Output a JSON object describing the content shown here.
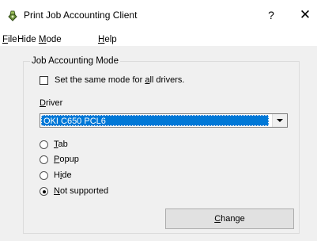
{
  "window": {
    "title": "Print Job Accounting Client",
    "help_glyph": "?",
    "close_glyph": "✕"
  },
  "menu": [
    {
      "pre": "",
      "key": "F",
      "post": "ile"
    },
    {
      "pre": "Hide ",
      "key": "M",
      "post": "ode"
    },
    {
      "pre": "",
      "key": "H",
      "post": "elp"
    }
  ],
  "group": {
    "title": "Job Accounting Mode",
    "same_mode_checkbox": {
      "pre": "Set the same mode for ",
      "key": "a",
      "post": "ll drivers.",
      "checked": false
    },
    "driver_label": {
      "pre": "",
      "key": "D",
      "post": "river"
    },
    "driver_value": "OKI C650 PCL6",
    "radios": [
      {
        "pre": "",
        "key": "T",
        "post": "ab",
        "selected": false
      },
      {
        "pre": "",
        "key": "P",
        "post": "opup",
        "selected": false
      },
      {
        "pre": "H",
        "key": "i",
        "post": "de",
        "selected": false
      },
      {
        "pre": "",
        "key": "N",
        "post": "ot supported",
        "selected": true
      }
    ],
    "change_button": {
      "pre": "",
      "key": "C",
      "post": "hange"
    }
  },
  "colors": {
    "selection": "#0078d7",
    "dialog_bg": "#f0f0f0"
  }
}
